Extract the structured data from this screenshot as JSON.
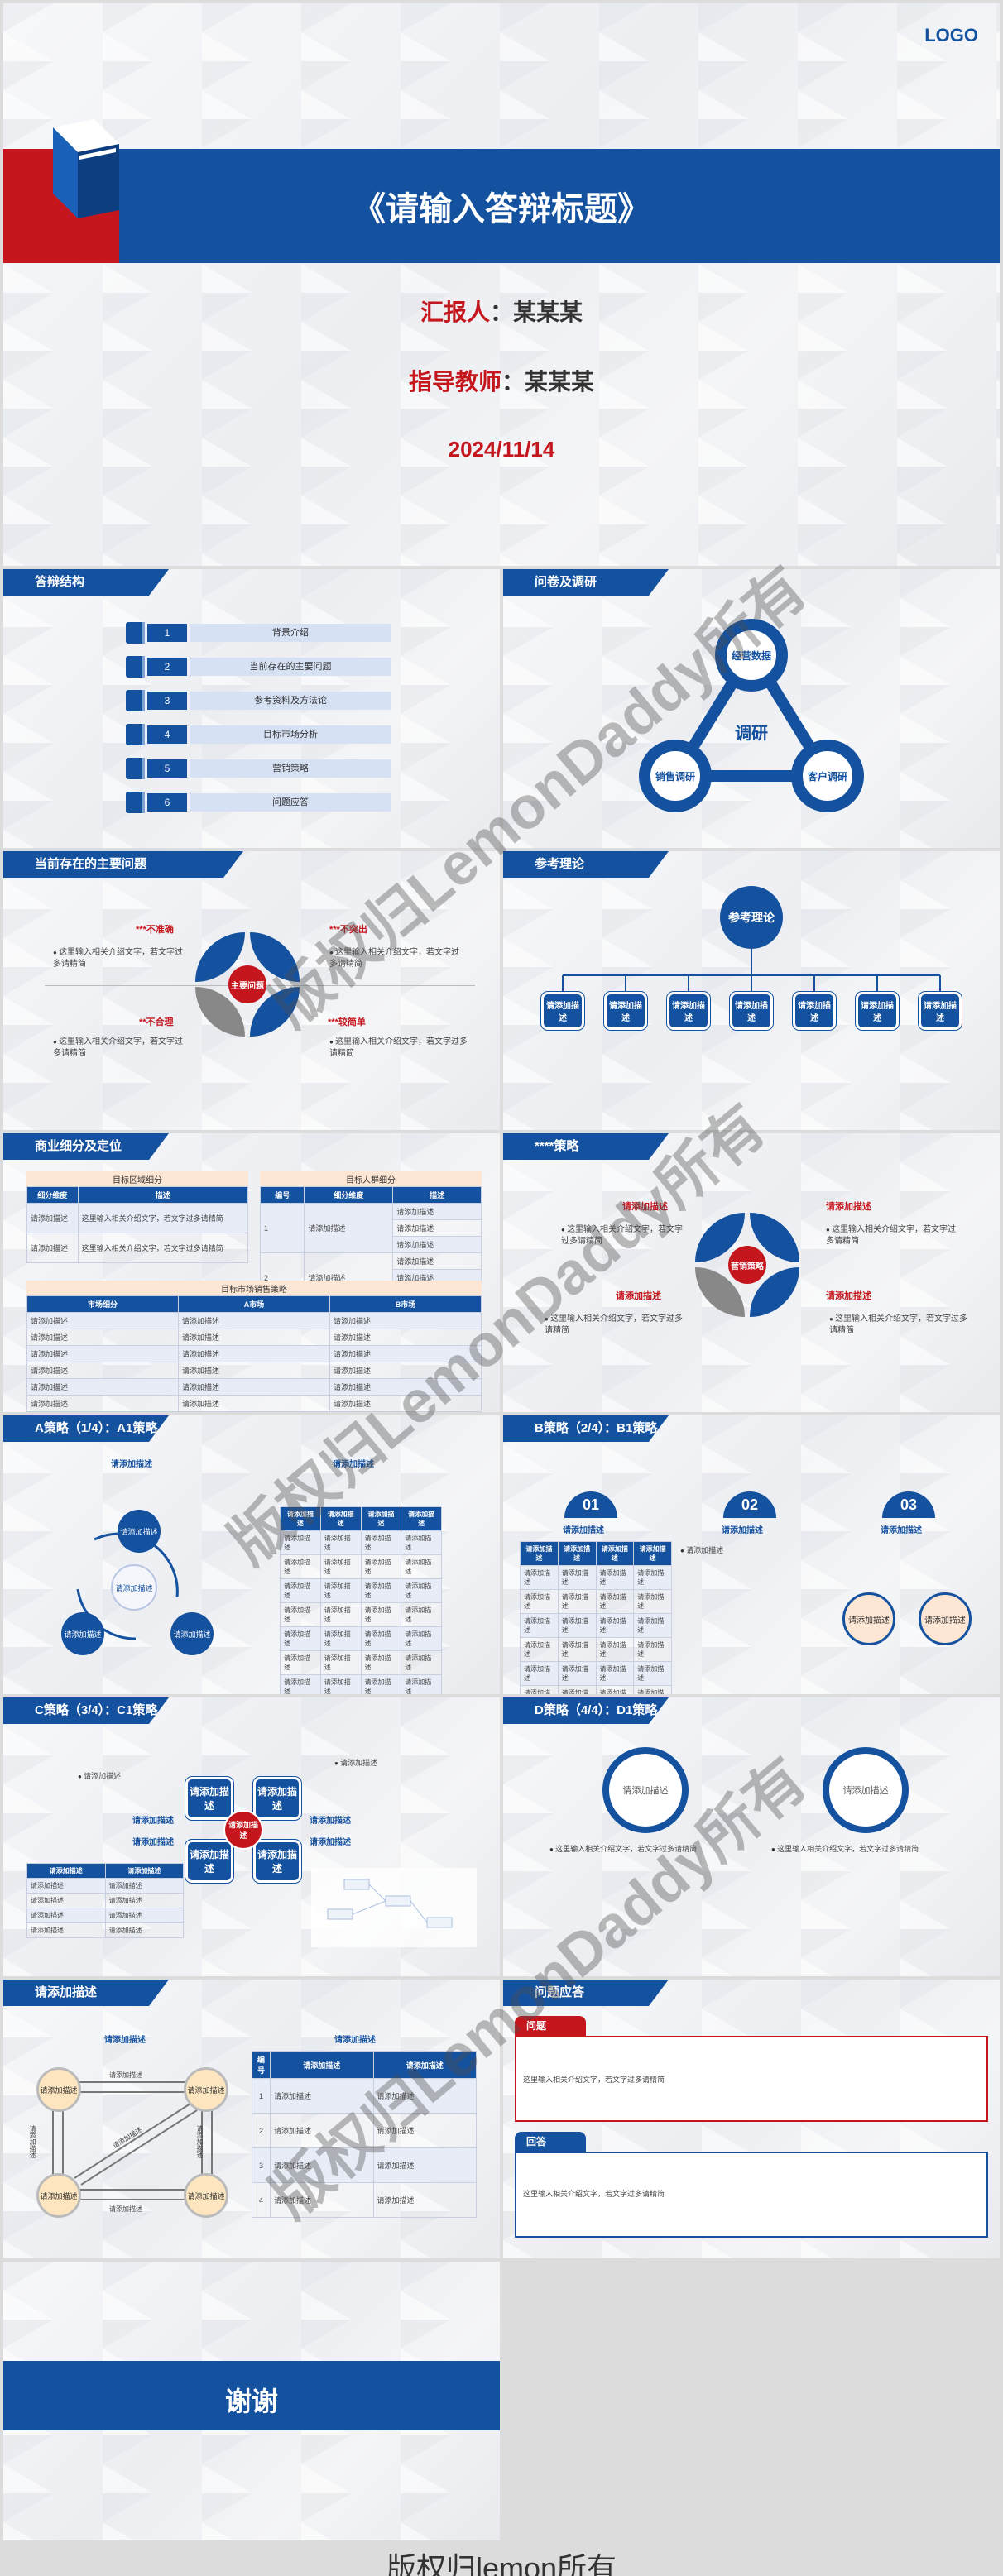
{
  "s1": {
    "logo": "LOGO",
    "title": "《请输入答辩标题》",
    "reporter_label": "汇报人",
    "reporter": "：某某某",
    "advisor_label": "指导教师",
    "advisor": "：某某某",
    "date": "2024/11/14"
  },
  "s2": {
    "header": "答辩结构",
    "items": [
      {
        "num": "1",
        "label": "背景介绍"
      },
      {
        "num": "2",
        "label": "当前存在的主要问题"
      },
      {
        "num": "3",
        "label": "参考资料及方法论"
      },
      {
        "num": "4",
        "label": "目标市场分析"
      },
      {
        "num": "5",
        "label": "营销策略"
      },
      {
        "num": "6",
        "label": "问题应答"
      }
    ]
  },
  "s3": {
    "header": "问卷及调研",
    "center": "调研",
    "top": "经营数据",
    "left": "销售调研",
    "right": "客户调研"
  },
  "s4": {
    "header": "当前存在的主要问题",
    "center": "主要问题",
    "q1": "***不准确",
    "q2": "***不突出",
    "q3": "**不合理",
    "q4": "***较简单",
    "desc": "这里输入相关介绍文字，若文字过多请精简",
    "desc_short": "这里输入相关介绍文字，若文字过多请精简"
  },
  "s5": {
    "header": "参考理论",
    "root": "参考理论",
    "leaf": "请添加描述"
  },
  "s6": {
    "header": "商业细分及定位",
    "t1_title": "目标区域细分",
    "t1_h1": "细分维度",
    "t1_h2": "描述",
    "t1_cell": "请添加描述",
    "t1_desc": "这里输入相关介绍文字，若文字过多请精简",
    "t2_title": "目标人群细分",
    "t2_h1": "编号",
    "t2_h2": "细分维度",
    "t2_h3": "描述",
    "t2_cell": "请添加描述",
    "t3_title": "目标市场销售策略",
    "t3_h1": "市场细分",
    "t3_h2": "A市场",
    "t3_h3": "B市场",
    "t3_cell": "请添加描述"
  },
  "s7": {
    "header": "****策略",
    "label": "请添加描述",
    "center": "营销策略",
    "desc": "这里输入相关介绍文字，若文字过多请精简"
  },
  "s8": {
    "header": "A策略（1/4）：A1策略",
    "label": "请添加描述",
    "center": "请添加描述",
    "node": "请添加描述",
    "th": "请添加描述",
    "td": "请添加描述"
  },
  "s9": {
    "header": "B策略（2/4）：B1策略",
    "n1": "01",
    "n2": "02",
    "n3": "03",
    "label": "请添加描述",
    "th": "请添加描述",
    "td": "请添加描述",
    "bullet": "请添加描述",
    "c1": "请添加描述",
    "c2": "请添加描述"
  },
  "s10": {
    "header": "C策略（3/4）：C1策略",
    "box": "请添加描述",
    "center": "请添加描述",
    "bullet": "请添加描述",
    "label": "请添加描述",
    "th": "请添加描述",
    "td": "请添加描述"
  },
  "s11": {
    "header": "D策略（4/4）：D1策略",
    "c1": "请添加描述",
    "c2": "请添加描述",
    "desc": "这里输入相关介绍文字，若文字过多请精简"
  },
  "s12": {
    "header": "请添加描述",
    "label": "请添加描述",
    "node": "请添加描述",
    "edge": "请添加描述",
    "th_no": "编号",
    "th": "请添加描述",
    "td": "请添加描述",
    "rows": [
      "1",
      "2",
      "3",
      "4"
    ]
  },
  "s13": {
    "header": "问题应答",
    "q": "问题",
    "a": "回答",
    "desc": "这里输入相关介绍文字，若文字过多请精简"
  },
  "s14": {
    "title": "谢谢"
  },
  "watermark": {
    "diag": "版权归LemonDaddy所有",
    "bottom": "版权归lemon所有"
  },
  "colors": {
    "brand": "#1452a0",
    "accent": "#c4161c"
  }
}
